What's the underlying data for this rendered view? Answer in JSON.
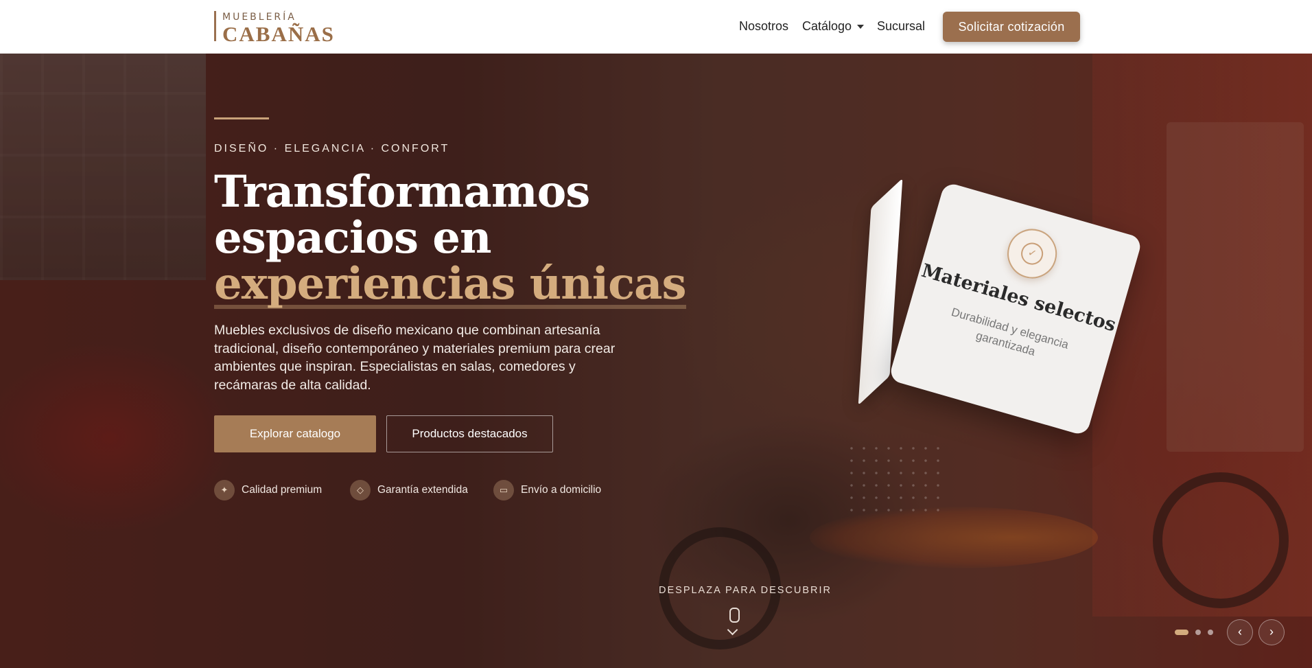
{
  "brand": {
    "top": "MUEBLERÍA",
    "main": "CABAÑAS"
  },
  "nav": {
    "items": [
      {
        "label": "Nosotros"
      },
      {
        "label": "Catálogo"
      },
      {
        "label": "Sucursal"
      }
    ],
    "cta": "Solicitar cotización"
  },
  "hero": {
    "eyebrow": "DISEÑO · ELEGANCIA · CONFORT",
    "headline": {
      "line1": "Transformamos",
      "line2": "espacios en",
      "line3": "experiencias únicas"
    },
    "description": "Muebles exclusivos de diseño mexicano que combinan artesanía tradicional, diseño contemporáneo y materiales premium para crear ambientes que inspiran. Especialistas en salas, comedores y recámaras de alta calidad.",
    "primary_button": "Explorar catalogo",
    "secondary_button": "Productos destacados",
    "features": [
      {
        "label": "Calidad premium",
        "icon": "sparkle-icon"
      },
      {
        "label": "Garantía extendida",
        "icon": "shield-icon"
      },
      {
        "label": "Envío a domicilio",
        "icon": "truck-icon"
      }
    ]
  },
  "card": {
    "title": "Materiales selectos",
    "subtitle": "Durabilidad y elegancia garantizada",
    "icon": "badge-check-icon"
  },
  "scroll": {
    "label": "DESPLAZA PARA DESCUBRIR"
  },
  "carousel": {
    "slides": 3,
    "active_index": 0
  },
  "colors": {
    "accent": "#a67c56",
    "gold": "#d4ac7e",
    "header_bg": "#ffffff"
  }
}
